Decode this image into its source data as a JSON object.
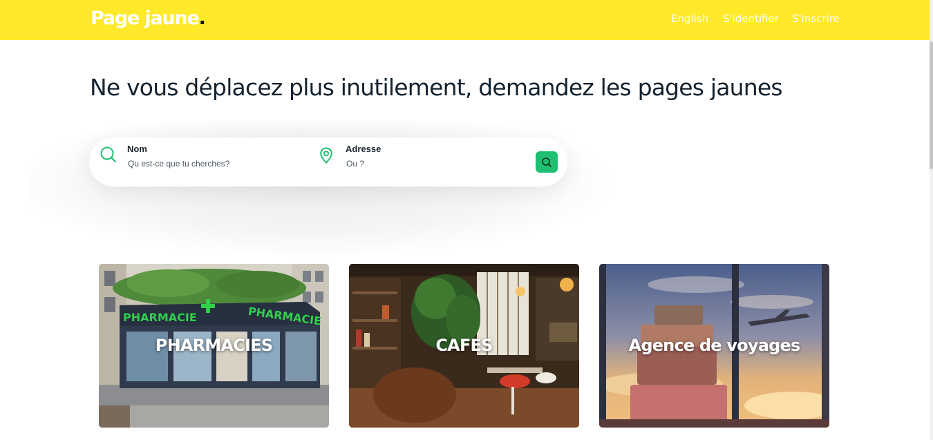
{
  "header": {
    "logo": "Page jaune",
    "logo_dot": ".",
    "nav": {
      "english": "English",
      "login": "S'identifier",
      "signup": "S'inscrire"
    }
  },
  "hero": {
    "title": "Ne vous déplacez plus inutilement, demandez les pages jaunes"
  },
  "search": {
    "name_label": "Nom",
    "name_placeholder": "Qu est-ce que tu cherches?",
    "address_label": "Adresse",
    "address_placeholder": "Ou ?",
    "button_icon": "search-icon"
  },
  "categories": [
    {
      "title": "PHARMACIES",
      "sign_text": "PHARMACIE"
    },
    {
      "title": "CAFES"
    },
    {
      "title": "Agence de voyages"
    }
  ],
  "colors": {
    "header_bg": "#ffe929",
    "accent_green": "#1fbf72",
    "title_text": "#13222f"
  }
}
